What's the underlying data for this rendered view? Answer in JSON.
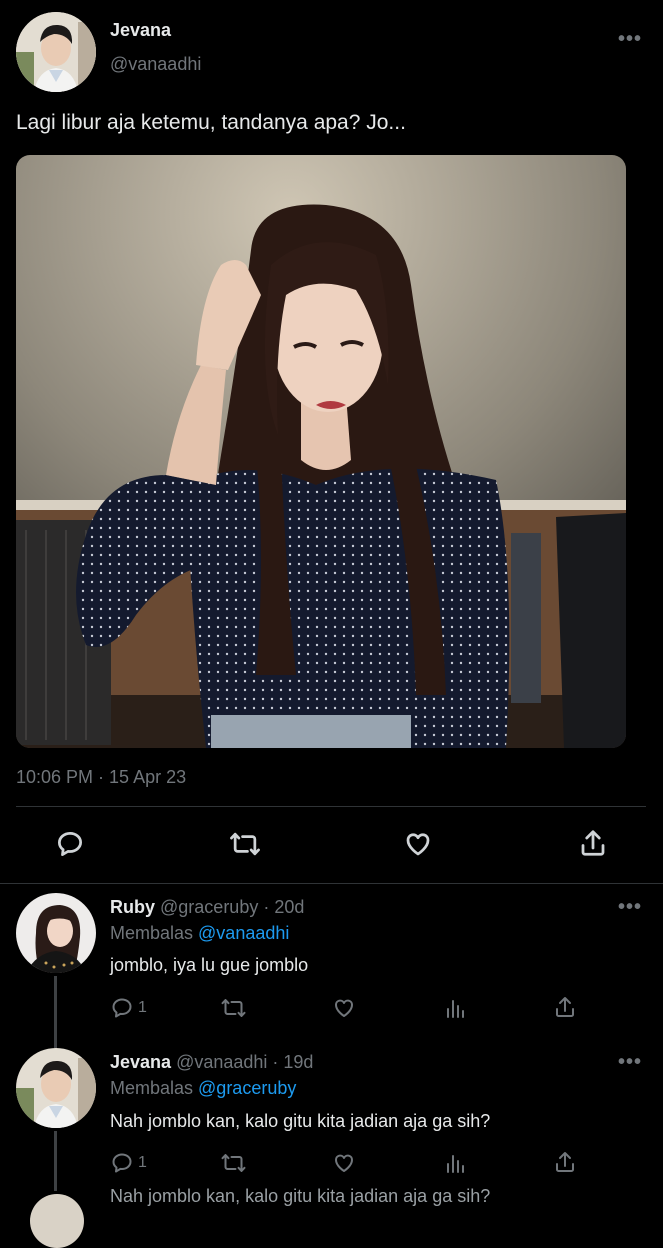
{
  "main_tweet": {
    "author_name": "Jevana",
    "author_handle": "@vanaadhi",
    "text": "Lagi libur aja ketemu, tandanya apa? Jo...",
    "timestamp": "10:06 PM · 15 Apr 23",
    "more_label": "•••"
  },
  "replies": [
    {
      "name": "Ruby",
      "meta": "@graceruby · 20d",
      "replying_prefix": "Membalas ",
      "replying_to": "@vanaadhi",
      "text": "jomblo, iya lu gue jomblo",
      "reply_count": "1",
      "more_label": "•••"
    },
    {
      "name": "Jevana",
      "meta": "@vanaadhi · 19d",
      "replying_prefix": "Membalas ",
      "replying_to": "@graceruby",
      "text": "Nah jomblo kan, kalo gitu kita jadian aja ga sih?",
      "reply_count": "1",
      "more_label": "•••"
    }
  ],
  "cutoff_text": "Nah jomblo kan, kalo gitu kita jadian aja ga sih?",
  "icons": [
    "more-icon",
    "reply-icon",
    "retweet-icon",
    "like-icon",
    "share-icon",
    "views-icon"
  ]
}
